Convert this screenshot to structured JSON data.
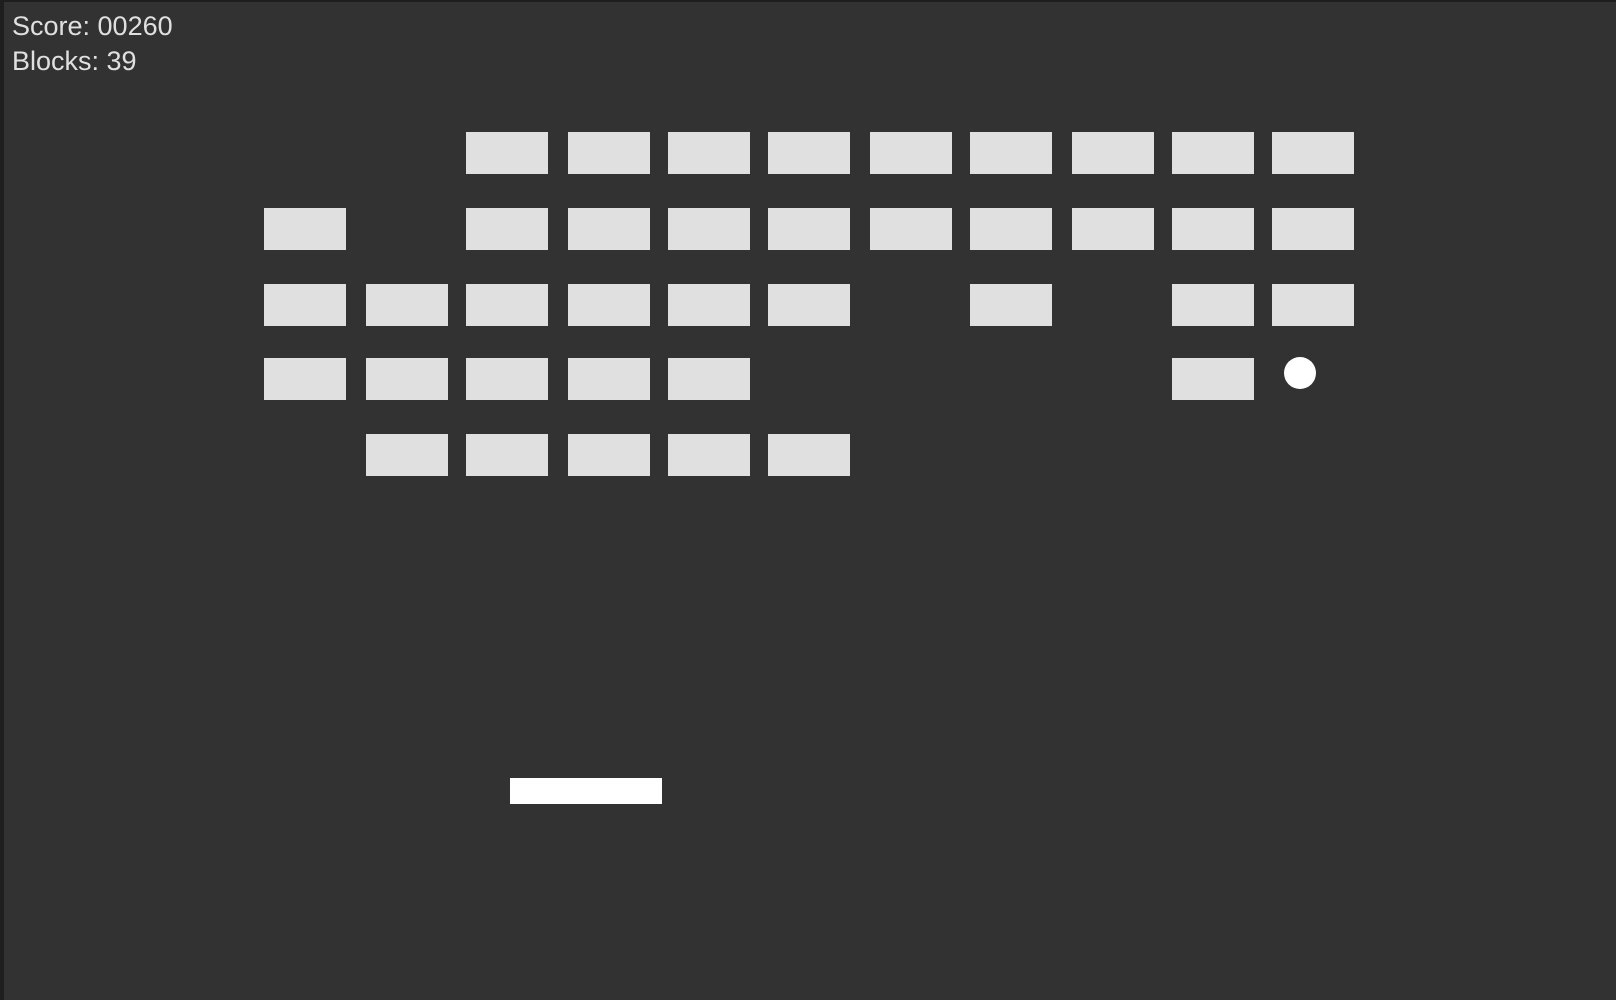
{
  "hud": {
    "score_text": "Score: 00260",
    "blocks_text": "Blocks: 39"
  },
  "bricks": {
    "columns": 11,
    "rows": 5,
    "layout": [
      [
        0,
        0,
        1,
        1,
        1,
        1,
        1,
        1,
        1,
        1,
        1
      ],
      [
        1,
        0,
        1,
        1,
        1,
        1,
        1,
        1,
        1,
        1,
        1
      ],
      [
        1,
        1,
        1,
        1,
        1,
        1,
        0,
        1,
        0,
        1,
        1
      ],
      [
        1,
        1,
        1,
        1,
        1,
        0,
        0,
        0,
        0,
        1,
        0
      ],
      [
        0,
        1,
        1,
        1,
        1,
        1,
        0,
        0,
        0,
        0,
        0
      ]
    ]
  },
  "colors": {
    "background": "#333233",
    "frame": "#1e1e1e",
    "hud_text": "#e0e0e0",
    "brick": "#e0e0e0",
    "paddle": "#ffffff",
    "ball": "#ffffff"
  }
}
